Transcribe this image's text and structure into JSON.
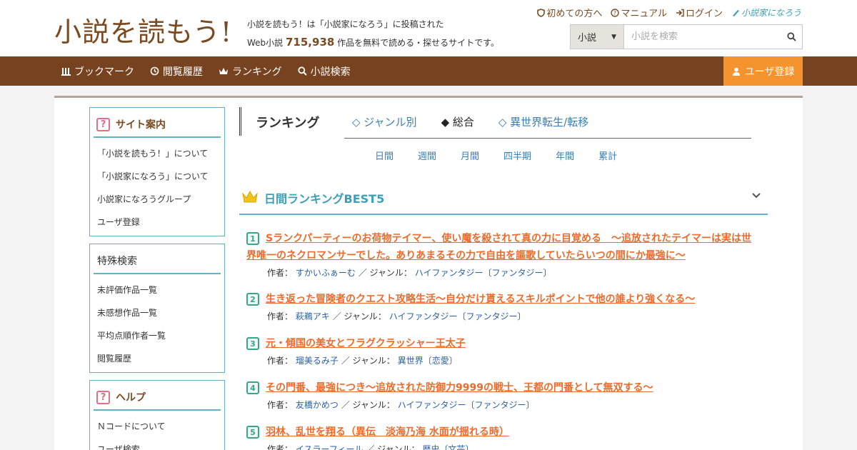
{
  "header": {
    "logo": "小説を読もう!",
    "tagline_1": "小説を読もう！は「小説家になろう」に投稿された",
    "tagline_2_prefix": "Web小説",
    "tagline_count": "715,938",
    "tagline_2_suffix": "作品を無料で読める・探せるサイトです。",
    "links": {
      "first": "初めての方へ",
      "manual": "マニュアル",
      "login": "ログイン",
      "brand": "小説家になろう"
    },
    "search": {
      "category": "小説",
      "placeholder": "小説を検索"
    }
  },
  "nav": {
    "bookmark": "ブックマーク",
    "history": "閲覧履歴",
    "ranking": "ランキング",
    "search": "小説検索",
    "register": "ユーザ登録"
  },
  "sidebar": {
    "site_guide": {
      "title": "サイト案内",
      "items": [
        "「小説を読もう！」について",
        "「小説家になろう」について",
        "小説家になろうグループ",
        "ユーザ登録"
      ]
    },
    "special": {
      "title": "特殊検索",
      "items": [
        "未評価作品一覧",
        "未感想作品一覧",
        "平均点順作者一覧",
        "閲覧履歴"
      ]
    },
    "help": {
      "title": "ヘルプ",
      "items": [
        "Ｎコードについて",
        "ユーザ検索"
      ]
    }
  },
  "ranking": {
    "title": "ランキング",
    "tabs": [
      "◇ ジャンル別",
      "◆ 総合",
      "◇ 異世界転生/転移"
    ],
    "periods": [
      "日間",
      "週間",
      "月間",
      "四半期",
      "年間",
      "累計"
    ],
    "best_title": "日間ランキングBEST5",
    "author_label": "作者：",
    "genre_label": "／ ジャンル：",
    "items": [
      {
        "rank": "1",
        "title": "Sランクパーティーのお荷物テイマー、使い魔を殺されて真の力に目覚める　〜追放されたテイマーは実は世界唯一のネクロマンサーでした。ありあまるその力で自由を謳歌していたらいつの間にか最強に〜",
        "author": "すかいふぁーむ",
        "genre": "ハイファンタジー〔ファンタジー〕"
      },
      {
        "rank": "2",
        "title": "生き返った冒険者のクエスト攻略生活～自分だけ貰えるスキルポイントで他の誰より強くなる～",
        "author": "萩鵜アキ",
        "genre": "ハイファンタジー〔ファンタジー〕"
      },
      {
        "rank": "3",
        "title": "元・傾国の美女とフラグクラッシャー王太子",
        "author": "瑠美るみ子",
        "genre": "異世界〔恋愛〕"
      },
      {
        "rank": "4",
        "title": "その門番、最強につき～追放された防御力9999の戦士、王都の門番として無双する～",
        "author": "友橋かめつ",
        "genre": "ハイファンタジー〔ファンタジー〕"
      },
      {
        "rank": "5",
        "title": "羽林、乱世を翔る（異伝　淡海乃海 水面が揺れる時）",
        "author": "イスラーフィール",
        "genre": "歴史〔文芸〕"
      }
    ]
  },
  "colors": {
    "brown": "#77421f",
    "orange": "#f5932e",
    "teal": "#62b4c4",
    "title_orange": "#ec6b2d",
    "link_blue": "#2a5fa8"
  }
}
